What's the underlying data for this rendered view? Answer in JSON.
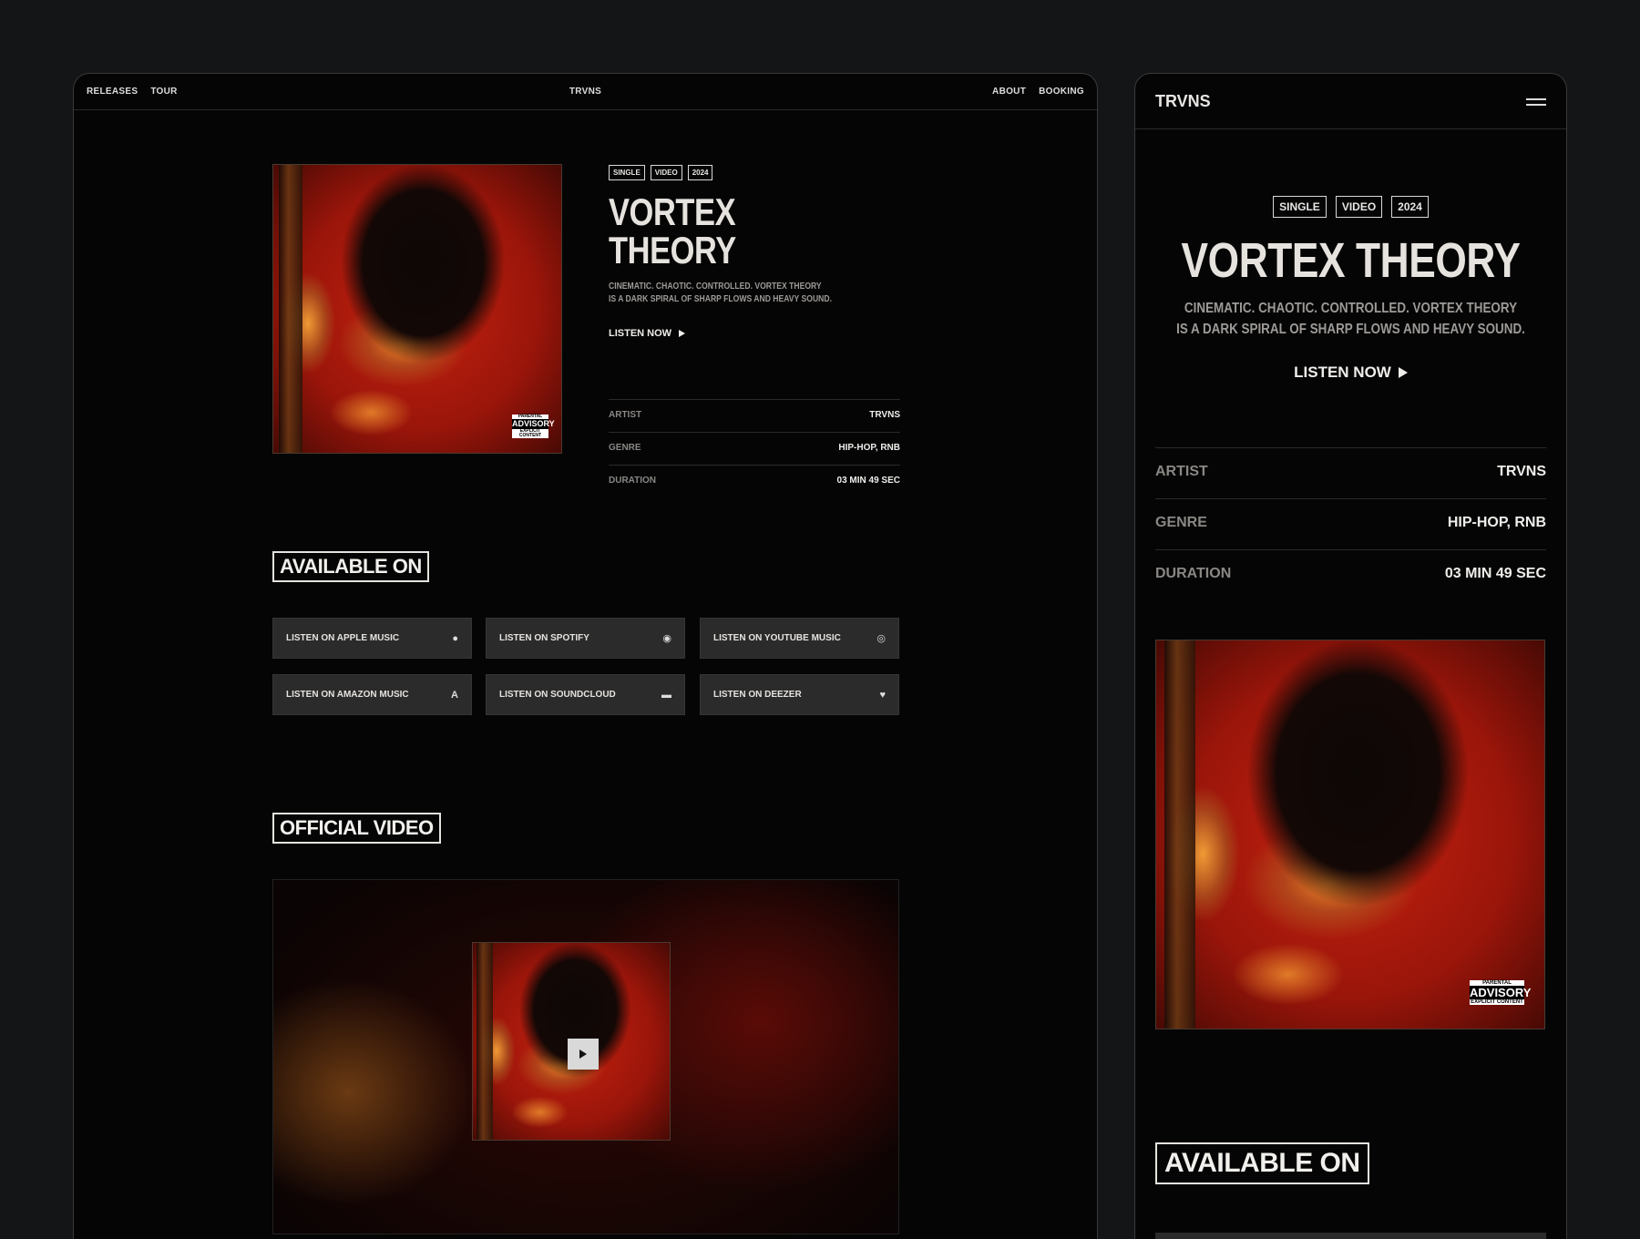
{
  "brand": "TRVNS",
  "desktop": {
    "nav": {
      "left": [
        "RELEASES",
        "TOUR"
      ],
      "center": "TRVNS",
      "right": [
        "ABOUT",
        "BOOKING"
      ]
    }
  },
  "release": {
    "tags": [
      "SINGLE",
      "VIDEO",
      "2024"
    ],
    "title": "VORTEX THEORY",
    "description_line1": "CINEMATIC. CHAOTIC. CONTROLLED. VORTEX THEORY",
    "description_line2": "IS A DARK SPIRAL OF SHARP FLOWS AND HEAVY SOUND.",
    "listen_label": "LISTEN NOW",
    "meta": [
      {
        "key": "ARTIST",
        "value": "TRVNS"
      },
      {
        "key": "GENRE",
        "value": "HIP-HOP, RNB"
      },
      {
        "key": "DURATION",
        "value": "03 MIN 49 SEC"
      }
    ],
    "advisory": {
      "top": "PARENTAL",
      "main": "ADVISORY",
      "bottom": "EXPLICIT CONTENT"
    }
  },
  "available_on": {
    "label": "AVAILABLE ON",
    "buttons": [
      {
        "label": "LISTEN ON APPLE MUSIC",
        "icon": "apple-icon",
        "glyph": "●"
      },
      {
        "label": "LISTEN ON SPOTIFY",
        "icon": "spotify-icon",
        "glyph": "◉"
      },
      {
        "label": "LISTEN ON YOUTUBE MUSIC",
        "icon": "youtube-music-icon",
        "glyph": "◎"
      },
      {
        "label": "LISTEN ON AMAZON MUSIC",
        "icon": "amazon-icon",
        "glyph": "a"
      },
      {
        "label": "LISTEN ON SOUNDCLOUD",
        "icon": "soundcloud-icon",
        "glyph": "▬"
      },
      {
        "label": "LISTEN ON DEEZER",
        "icon": "deezer-icon",
        "glyph": "♥"
      }
    ]
  },
  "official_video": {
    "label": "OFFICIAL VIDEO"
  }
}
